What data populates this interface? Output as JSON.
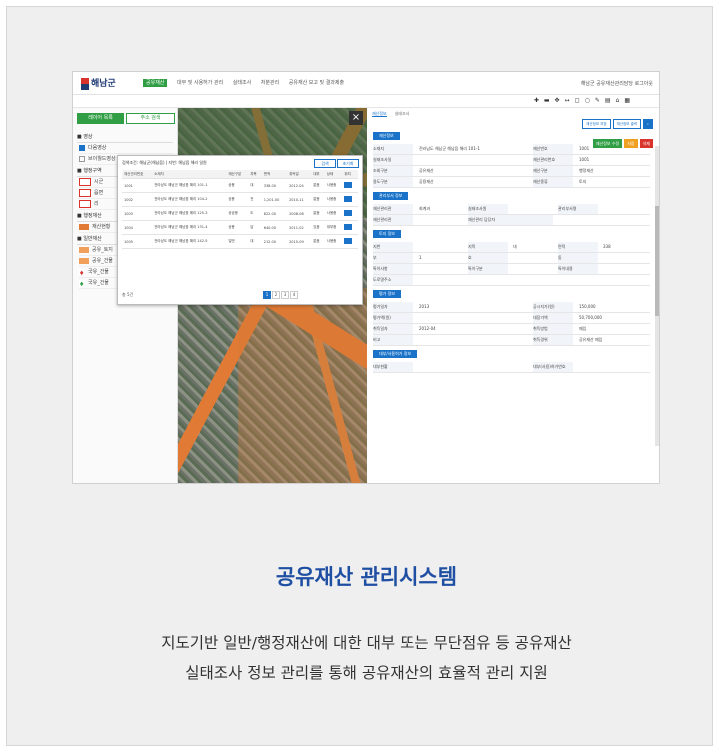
{
  "app": {
    "logo_text": "해남군",
    "menu": [
      "공유재산",
      "대부 및 사용허가 관리",
      "실태조사",
      "처분관리",
      "공유재산 보고 및 결과제출"
    ],
    "user": "해남군 공유재산관리담당  로그아웃"
  },
  "left_panel": {
    "tab_active": "레이어 목록",
    "tab_inactive": "주소 검색",
    "sections": [
      "영상",
      "행정구역",
      "행정재산",
      "일반재산"
    ],
    "layers": [
      "다음영상",
      "브이월드영상",
      "시군",
      "읍면",
      "리",
      "재산현황",
      "공유_토지",
      "공유_건물",
      "국유_건물",
      "국유_건물"
    ]
  },
  "map": {
    "close_icon": "×",
    "popup": {
      "header": "검색조건: 해남군(해남읍)  |  지번: 해남읍 해리 일원",
      "btn_search": "검색",
      "btn_reset": "초기화",
      "columns": [
        "재산관리번호",
        "소재지",
        "재산구분",
        "지목",
        "면적",
        "취득일",
        "대부",
        "상태",
        "위치"
      ],
      "rows": [
        [
          "1001",
          "전라남도 해남군 해남읍 해리 101-1",
          "공용",
          "대",
          "338.00",
          "2012-04",
          "없음",
          "사용중"
        ],
        [
          "1002",
          "전라남도 해남군 해남읍 해리 104-2",
          "공용",
          "전",
          "1,201.00",
          "2010-11",
          "없음",
          "사용중"
        ],
        [
          "1003",
          "전라남도 해남군 해남읍 해리 125-3",
          "공공용",
          "도",
          "822.00",
          "2008-06",
          "없음",
          "사용중"
        ],
        [
          "1004",
          "전라남도 해남군 해남읍 해리 131-4",
          "공용",
          "답",
          "640.00",
          "2011-02",
          "있음",
          "대부중"
        ],
        [
          "1005",
          "전라남도 해남군 해남읍 해리 142-5",
          "일반",
          "대",
          "212.00",
          "2015-09",
          "없음",
          "사용중"
        ]
      ],
      "pager": [
        "1",
        "2",
        "3",
        "4"
      ],
      "total": "총 5건"
    }
  },
  "right_panel": {
    "tabs": [
      "재산정보",
      "실태조사"
    ],
    "top_buttons": [
      "재산정보 저장",
      "재산정보 출력"
    ],
    "action_buttons": [
      "재산정보 수정",
      "저장",
      "삭제"
    ],
    "sections": {
      "basic": "재산정보",
      "management": "관리부서 정보",
      "land": "토지 정보",
      "price": "평가 정보",
      "loan": "대부/사용허가 정보"
    },
    "basic_rows": [
      [
        "소재지",
        "전라남도 해남군 해남읍 해리 101-1",
        "재산번호",
        "1001"
      ],
      [
        "실태조사일",
        "",
        "재산관리번호",
        "1001"
      ],
      [
        "조회구분",
        "공유재산",
        "재산구분",
        "행정재산"
      ],
      [
        "용도구분",
        "공용재산",
        "재산종류",
        "토지"
      ]
    ],
    "mgmt_rows": [
      [
        "재산관리관",
        "회계과",
        "실태조사원",
        "",
        "관리부서명",
        ""
      ],
      [
        "재산관리관",
        "",
        "재산관리 담당자",
        ""
      ]
    ],
    "land_rows": [
      [
        "지번",
        "",
        "지목",
        "대",
        "면적",
        "338"
      ],
      [
        "부",
        "1",
        "호",
        "",
        "동",
        ""
      ],
      [
        "특이사항",
        "",
        "특이구분",
        "",
        "특이내용",
        ""
      ],
      [
        "도로명주소",
        ""
      ]
    ],
    "price_rows": [
      [
        "평가일자",
        "2013",
        "공시지가(원)",
        "150,000"
      ],
      [
        "평가액(원)",
        "",
        "대장가액",
        "50,700,000"
      ],
      [
        "취득일자",
        "2012-04",
        "취득방법",
        "매입"
      ],
      [
        "비고",
        "",
        "취득경위",
        "공유재산 매입"
      ]
    ],
    "loan_rows": [
      [
        "대부현황",
        "",
        "대부(사용)허가번호",
        ""
      ]
    ]
  },
  "caption": {
    "title": "공유재산 관리시스템",
    "line1": "지도기반 일반/행정재산에 대한 대부 또는 무단점유 등 공유재산",
    "line2": "실태조사 정보 관리를 통해 공유재산의 효율적 관리 지원"
  }
}
